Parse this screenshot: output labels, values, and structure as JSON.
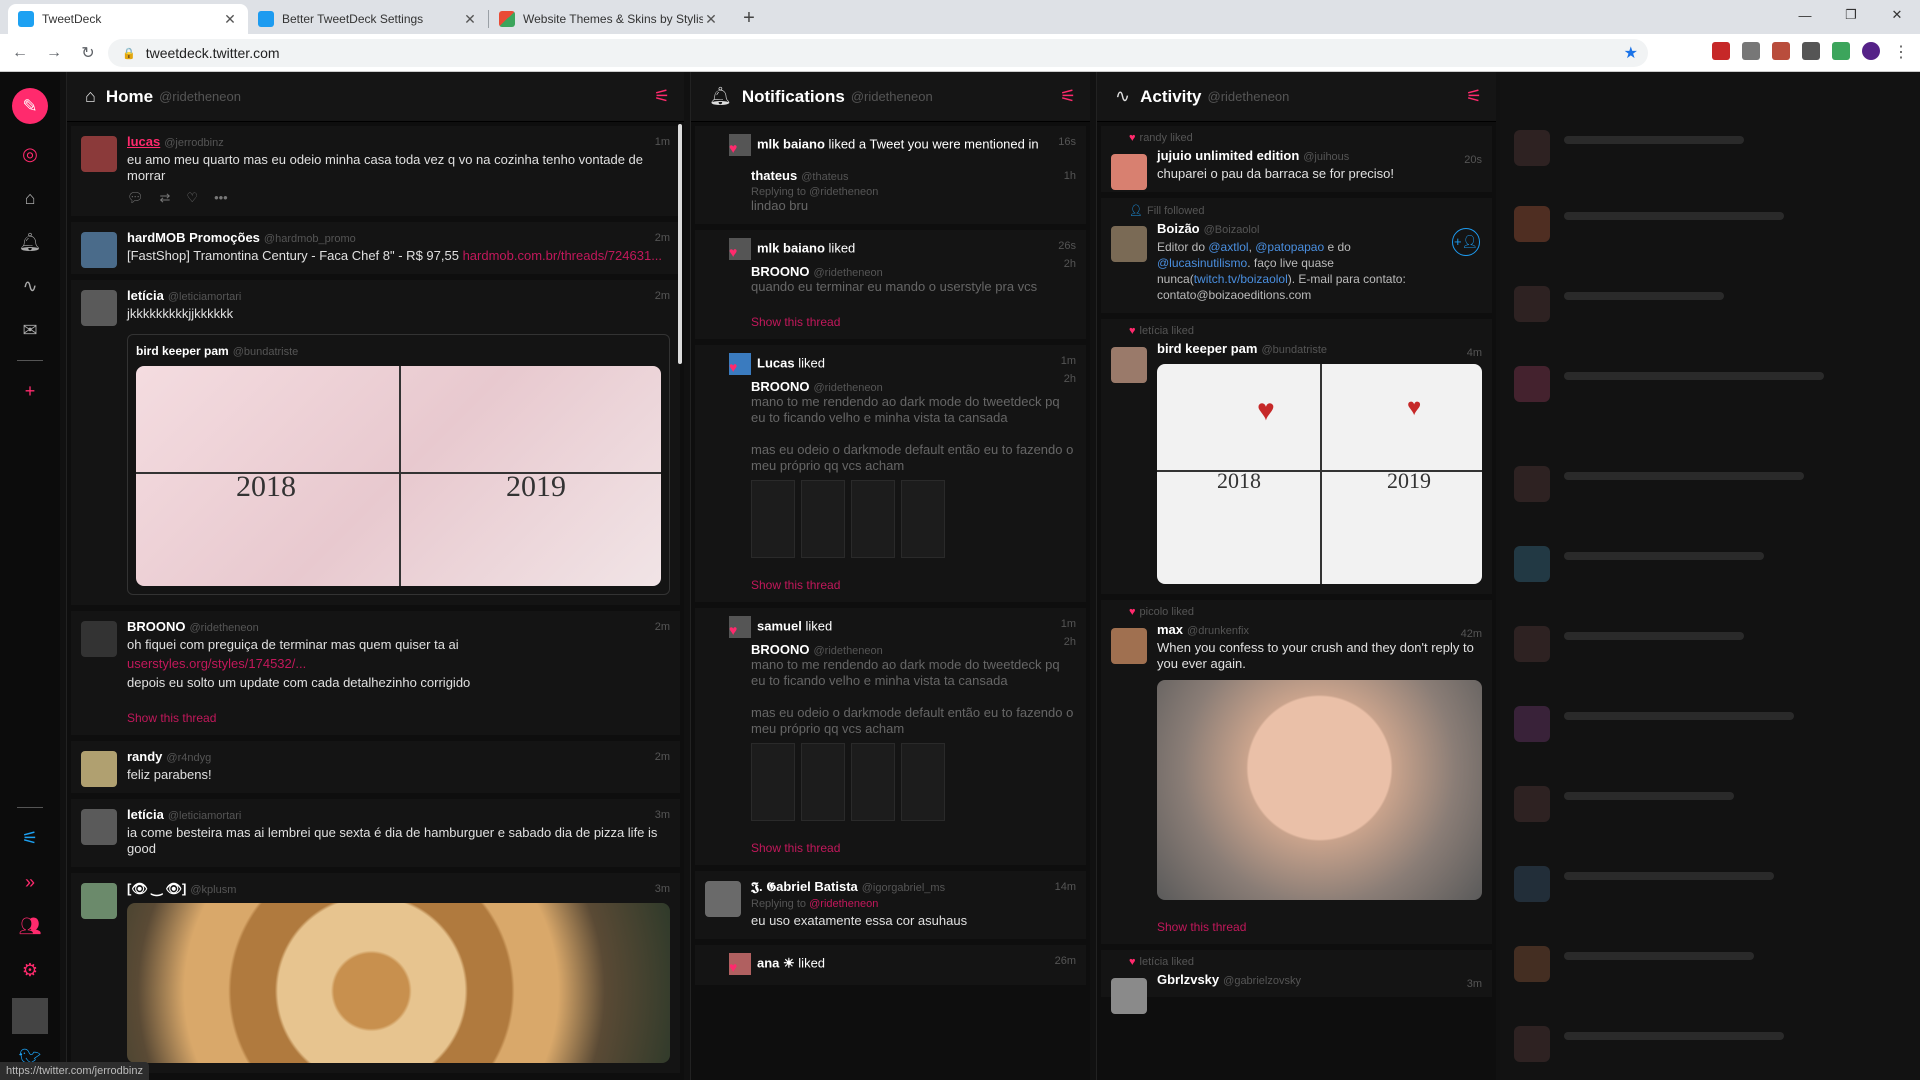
{
  "browser": {
    "tabs": [
      {
        "label": "TweetDeck",
        "active": true,
        "color": "#1da1f2"
      },
      {
        "label": "Better TweetDeck Settings",
        "active": false,
        "color": "#1d9bf0"
      },
      {
        "label": "Website Themes & Skins by Stylish",
        "active": false,
        "color": "#e94b35"
      }
    ],
    "url": "tweetdeck.twitter.com",
    "status_url": "https://twitter.com/jerrodbinz"
  },
  "columns": {
    "home": {
      "title": "Home",
      "handle": "@ridetheneon",
      "tweets": [
        {
          "name": "lucas",
          "handle": "@jerrodbinz",
          "time": "1m",
          "text": "eu amo meu quarto mas eu odeio minha casa toda vez q vo na cozinha tenho vontade de morrar"
        },
        {
          "name": "hardMOB Promoções",
          "handle": "@hardmob_promo",
          "time": "2m",
          "text": "[FastShop] Tramontina Century - Faca Chef 8\" - R$ 97,55",
          "link": "hardmob.com.br/threads/724631..."
        },
        {
          "name": "letícia",
          "handle": "@leticiamortari",
          "time": "2m",
          "text": "jkkkkkkkkkjjkkkkkk",
          "quote_name": "bird keeper pam",
          "quote_handle": "@bundatriste",
          "year1": "2018",
          "year2": "2019"
        },
        {
          "name": "BROONO",
          "handle": "@ridetheneon",
          "time": "2m",
          "text": "oh fiquei com preguiça de terminar mas quem quiser ta ai",
          "link": "userstyles.org/styles/174532/...",
          "text2": "depois eu solto um update com cada detalhezinho corrigido",
          "thread": "Show this thread"
        },
        {
          "name": "randy",
          "handle": "@r4ndyg",
          "time": "2m",
          "text": "feliz parabens!"
        },
        {
          "name": "letícia",
          "handle": "@leticiamortari",
          "time": "3m",
          "text": "ia come besteira mas ai lembrei que sexta é dia de hamburguer e sabado dia de pizza life is good"
        },
        {
          "name": "[👁 ‿ 👁]",
          "handle": "@kplusm",
          "time": "3m"
        }
      ]
    },
    "notifications": {
      "title": "Notifications",
      "handle": "@ridetheneon",
      "items": [
        {
          "actor": "mlk baiano",
          "action": "liked a Tweet you were mentioned in",
          "time": "16s",
          "name": "thateus",
          "handle": "@thateus",
          "time2": "1h",
          "reply": "Replying to",
          "reply_to": "@ridetheneon",
          "text": "lindao bru"
        },
        {
          "actor": "mlk baiano",
          "action": "liked",
          "time": "26s",
          "name": "BROONO",
          "handle": "@ridetheneon",
          "time2": "2h",
          "text": "quando eu terminar eu mando o userstyle pra vcs",
          "thread": "Show this thread"
        },
        {
          "actor": "Lucas",
          "action": "liked",
          "time": "1m",
          "name": "BROONO",
          "handle": "@ridetheneon",
          "time2": "2h",
          "text": "mano to me rendendo ao dark mode do tweetdeck pq eu to ficando velho e minha vista ta cansada",
          "text2": "mas eu odeio o darkmode default então eu to fazendo o meu próprio qq vcs acham",
          "thread": "Show this thread"
        },
        {
          "actor": "samuel",
          "action": "liked",
          "time": "1m",
          "name": "BROONO",
          "handle": "@ridetheneon",
          "time2": "2h",
          "text": "mano to me rendendo ao dark mode do tweetdeck pq eu to ficando velho e minha vista ta cansada",
          "text2": "mas eu odeio o darkmode default então eu to fazendo o meu próprio qq vcs acham",
          "thread": "Show this thread"
        },
        {
          "name": "𝕵. 𝕲abriel Batista",
          "handle": "@igorgabriel_ms",
          "time": "14m",
          "reply": "Replying to",
          "reply_to": "@ridetheneon",
          "text": "eu uso exatamente essa cor asuhaus"
        },
        {
          "actor": "ana ☀",
          "action": "liked",
          "time": "26m"
        }
      ]
    },
    "activity": {
      "title": "Activity",
      "handle": "@ridetheneon",
      "items": [
        {
          "label": "randy liked",
          "name": "jujuio unlimited edition",
          "handle": "@juihous",
          "time": "20s",
          "text": "chuparei o pau da barraca se for preciso!"
        },
        {
          "label": "Fill followed",
          "name": "Boizão",
          "handle": "@Boizaolol",
          "text_a": "Editor do ",
          "m1": "@axtlol",
          "text_b": ", ",
          "m2": "@patopapao",
          "text_c": " e do ",
          "m3": "@lucasinutilismo",
          "text_d": ". faço live quase nunca(",
          "m4": "twitch.tv/boizaolol",
          "text_e": "). E-mail para contato: contato@boizaoeditions.com"
        },
        {
          "label": "letícia liked",
          "name": "bird keeper pam",
          "handle": "@bundatriste",
          "time": "4m",
          "year1": "2018",
          "year2": "2019"
        },
        {
          "label": "picolo liked",
          "name": "max",
          "handle": "@drunkenfix",
          "time": "42m",
          "text": "When you confess to your crush and they don't reply to you ever again.",
          "thread": "Show this thread"
        },
        {
          "label": "letícia liked",
          "name": "Gbrlzvsky",
          "handle": "@gabrielzovsky",
          "time": "3m"
        }
      ]
    }
  }
}
